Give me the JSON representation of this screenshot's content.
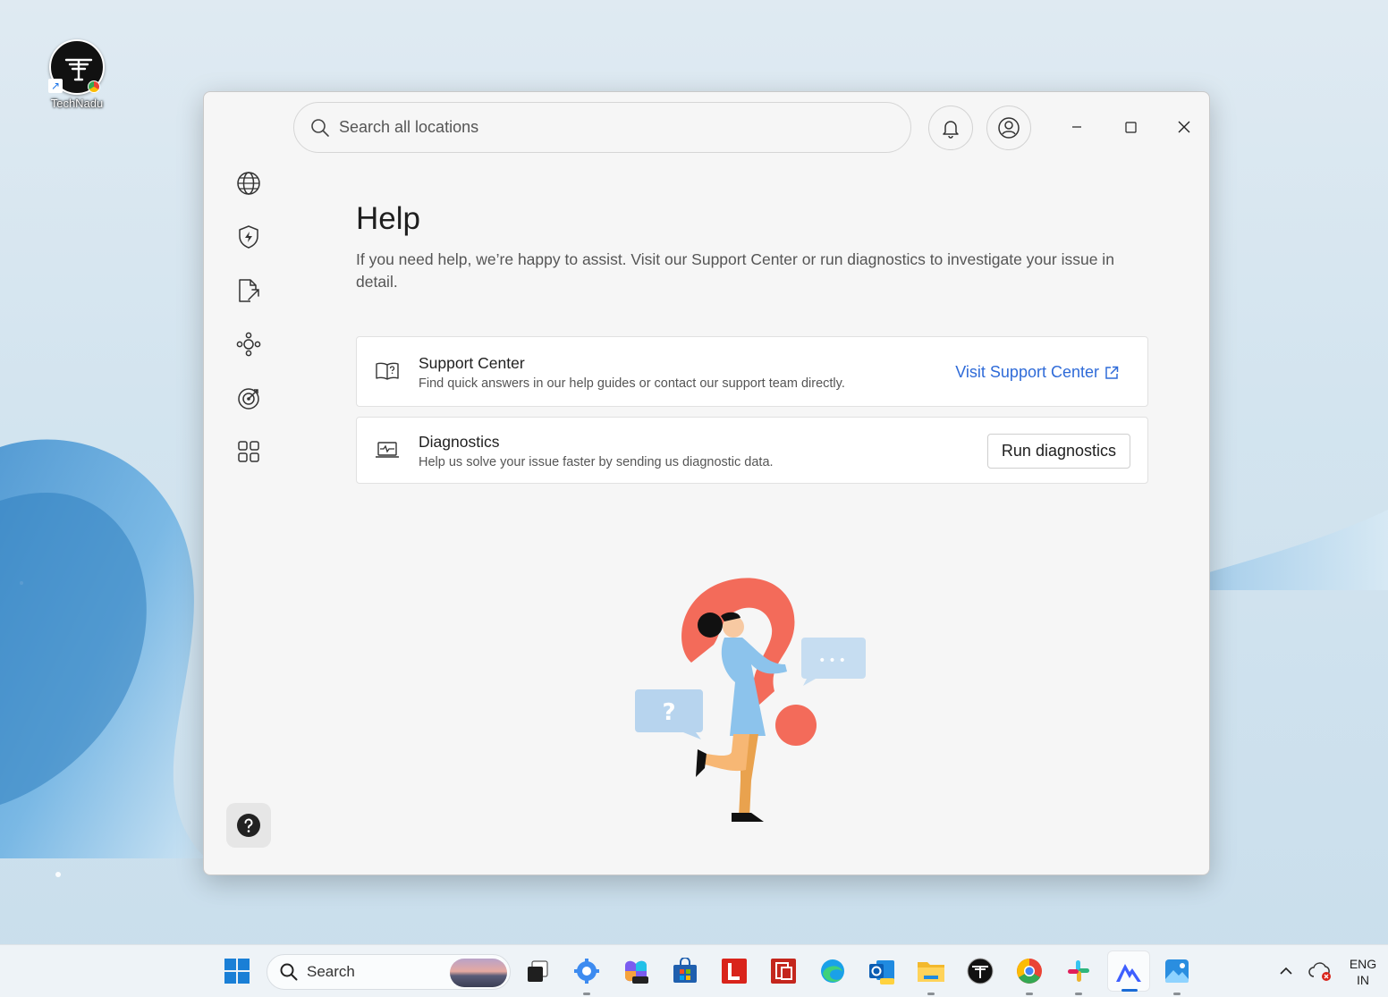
{
  "desktop": {
    "icons": [
      {
        "label": "TechNadu"
      }
    ]
  },
  "window": {
    "search": {
      "placeholder": "Search all locations"
    },
    "page": {
      "title": "Help",
      "description": "If you need help, we’re happy to assist. Visit our Support Center or run diagnostics to investigate your issue in detail."
    },
    "cards": [
      {
        "title": "Support Center",
        "subtitle": "Find quick answers in our help guides or contact our support team directly.",
        "action_label": "Visit Support Center",
        "icon": "book-question-icon"
      },
      {
        "title": "Diagnostics",
        "subtitle": "Help us solve your issue faster by sending us diagnostic data.",
        "action_label": "Run diagnostics",
        "icon": "laptop-pulse-icon"
      }
    ],
    "sidebar": [
      "globe-icon",
      "shield-bolt-icon",
      "file-share-icon",
      "mesh-network-icon",
      "target-icon",
      "apps-grid-icon"
    ],
    "illustration_marks": {
      "question": "?",
      "dots": "•••"
    }
  },
  "taskbar": {
    "search_label": "Search",
    "tray": {
      "lang": "ENG",
      "region": "IN"
    }
  },
  "colors": {
    "accent_link": "#2f6bd8",
    "illustration_red": "#f36b5a",
    "illustration_blue": "#8cc3ec"
  }
}
